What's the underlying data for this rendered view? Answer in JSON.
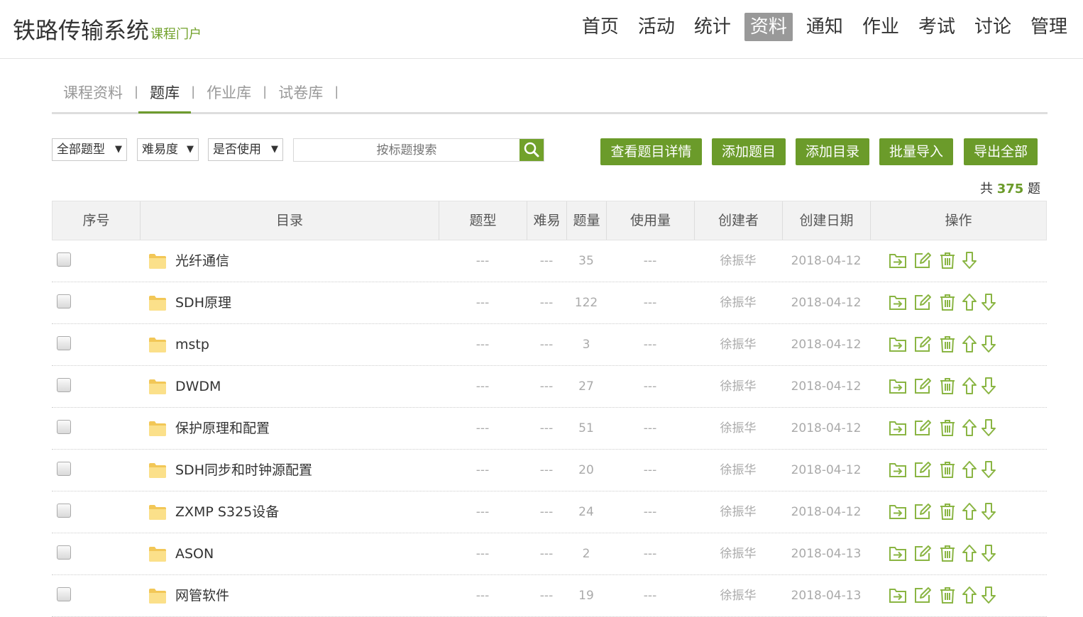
{
  "header": {
    "brand_name": "铁路传输系统",
    "brand_sub": "课程门户",
    "nav": [
      "首页",
      "活动",
      "统计",
      "资料",
      "通知",
      "作业",
      "考试",
      "讨论",
      "管理"
    ],
    "nav_active_index": 3
  },
  "subtabs": {
    "items": [
      "课程资料",
      "题库",
      "作业库",
      "试卷库"
    ],
    "active_index": 1
  },
  "filters": {
    "type": "全部题型",
    "difficulty": "难易度",
    "used": "是否使用",
    "search_placeholder": "按标题搜索"
  },
  "actions": [
    "查看题目详情",
    "添加题目",
    "添加目录",
    "批量导入",
    "导出全部"
  ],
  "total": {
    "prefix": "共",
    "count": "375",
    "suffix": "题"
  },
  "table": {
    "headers": [
      "序号",
      "目录",
      "题型",
      "难易",
      "题量",
      "使用量",
      "创建者",
      "创建日期",
      "操作"
    ],
    "rows": [
      {
        "name": "光纤通信",
        "type": "---",
        "difficulty": "---",
        "count": "35",
        "usage": "---",
        "creator": "徐振华",
        "date": "2018-04-12",
        "has_up": false
      },
      {
        "name": "SDH原理",
        "type": "---",
        "difficulty": "---",
        "count": "122",
        "usage": "---",
        "creator": "徐振华",
        "date": "2018-04-12",
        "has_up": true
      },
      {
        "name": "mstp",
        "type": "---",
        "difficulty": "---",
        "count": "3",
        "usage": "---",
        "creator": "徐振华",
        "date": "2018-04-12",
        "has_up": true
      },
      {
        "name": "DWDM",
        "type": "---",
        "difficulty": "---",
        "count": "27",
        "usage": "---",
        "creator": "徐振华",
        "date": "2018-04-12",
        "has_up": true
      },
      {
        "name": "保护原理和配置",
        "type": "---",
        "difficulty": "---",
        "count": "51",
        "usage": "---",
        "creator": "徐振华",
        "date": "2018-04-12",
        "has_up": true
      },
      {
        "name": "SDH同步和时钟源配置",
        "type": "---",
        "difficulty": "---",
        "count": "20",
        "usage": "---",
        "creator": "徐振华",
        "date": "2018-04-12",
        "has_up": true
      },
      {
        "name": "ZXMP S325设备",
        "type": "---",
        "difficulty": "---",
        "count": "24",
        "usage": "---",
        "creator": "徐振华",
        "date": "2018-04-12",
        "has_up": true
      },
      {
        "name": "ASON",
        "type": "---",
        "difficulty": "---",
        "count": "2",
        "usage": "---",
        "creator": "徐振华",
        "date": "2018-04-13",
        "has_up": true
      },
      {
        "name": "网管软件",
        "type": "---",
        "difficulty": "---",
        "count": "19",
        "usage": "---",
        "creator": "徐振华",
        "date": "2018-04-13",
        "has_up": true
      }
    ]
  },
  "colors": {
    "accent": "#6b9b2a",
    "icon": "#8ab543",
    "folder": "#f5d36b"
  },
  "icons": {
    "row_ops": [
      "move-to-folder-icon",
      "edit-icon",
      "delete-icon",
      "move-up-icon",
      "move-down-icon"
    ],
    "search": "search-icon",
    "folder": "folder-icon"
  }
}
